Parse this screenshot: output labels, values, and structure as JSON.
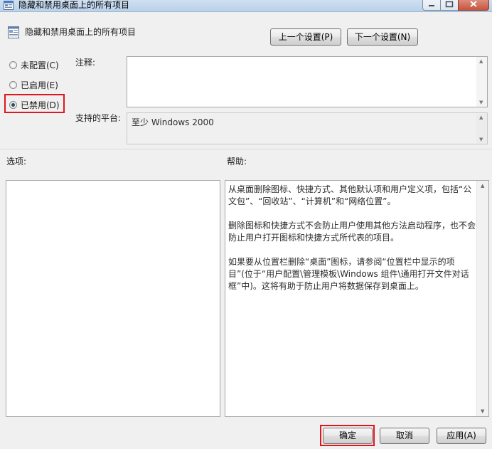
{
  "window": {
    "title": "隐藏和禁用桌面上的所有项目"
  },
  "policy": {
    "title": "隐藏和禁用桌面上的所有项目"
  },
  "nav": {
    "prev_label": "上一个设置(P)",
    "next_label": "下一个设置(N)"
  },
  "state": {
    "options": [
      {
        "label": "未配置(C)",
        "checked": false
      },
      {
        "label": "已启用(E)",
        "checked": false
      },
      {
        "label": "已禁用(D)",
        "checked": true
      }
    ]
  },
  "comment": {
    "label": "注释:",
    "value": ""
  },
  "platform": {
    "label": "支持的平台:",
    "value": "至少 Windows 2000"
  },
  "options_panel": {
    "label": "选项:"
  },
  "help_panel": {
    "label": "帮助:",
    "paragraphs": [
      "从桌面删除图标、快捷方式、其他默认项和用户定义项，包括“公文包”、“回收站”、“计算机”和“网络位置”。",
      "删除图标和快捷方式不会防止用户使用其他方法启动程序，也不会防止用户打开图标和快捷方式所代表的项目。",
      "如果要从位置栏删除“桌面”图标，请参阅“位置栏中显示的项目”(位于“用户配置\\管理模板\\Windows 组件\\通用打开文件对话框”中)。这将有助于防止用户将数据保存到桌面上。"
    ]
  },
  "footer": {
    "ok_label": "确定",
    "cancel_label": "取消",
    "apply_label": "应用(A)"
  },
  "colors": {
    "highlight": "#e0161e",
    "window_bg": "#f0f0f0"
  }
}
